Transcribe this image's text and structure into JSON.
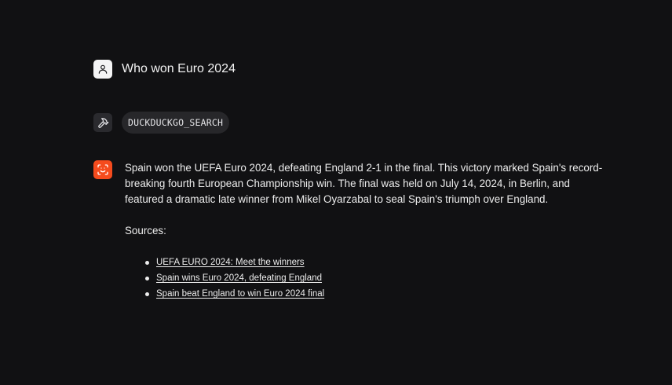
{
  "user_message": {
    "text": "Who won Euro 2024",
    "icon": "user-icon"
  },
  "tool_call": {
    "name": "DUCKDUCKGO_SEARCH",
    "icon": "hammer-icon"
  },
  "assistant_message": {
    "icon": "scan-face-icon",
    "accent_color": "#f54b1d",
    "paragraph": "Spain won the UEFA Euro 2024, defeating England 2-1 in the final. This victory marked Spain's record-breaking fourth European Championship win. The final was held on July 14, 2024, in Berlin, and featured a dramatic late winner from Mikel Oyarzabal to seal Spain's triumph over England.",
    "sources_label": "Sources:",
    "sources": [
      {
        "label": "UEFA EURO 2024: Meet the winners"
      },
      {
        "label": "Spain wins Euro 2024, defeating England"
      },
      {
        "label": "Spain beat England to win Euro 2024 final"
      }
    ]
  }
}
